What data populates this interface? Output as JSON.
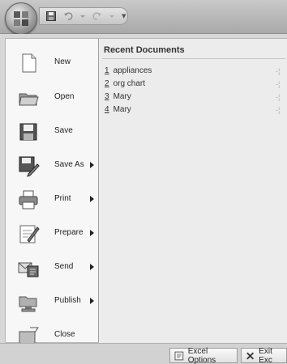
{
  "quick_access": {
    "qat_more": "▾"
  },
  "left_menu": [
    {
      "label": "New",
      "icon": "new-document-icon",
      "has_submenu": false
    },
    {
      "label": "Open",
      "icon": "open-folder-icon",
      "has_submenu": false
    },
    {
      "label": "Save",
      "icon": "save-disk-icon",
      "has_submenu": false
    },
    {
      "label": "Save As",
      "icon": "save-as-icon",
      "has_submenu": true
    },
    {
      "label": "Print",
      "icon": "printer-icon",
      "has_submenu": true
    },
    {
      "label": "Prepare",
      "icon": "prepare-icon",
      "has_submenu": true
    },
    {
      "label": "Send",
      "icon": "send-icon",
      "has_submenu": true
    },
    {
      "label": "Publish",
      "icon": "publish-icon",
      "has_submenu": true
    },
    {
      "label": "Close",
      "icon": "close-folder-icon",
      "has_submenu": false
    }
  ],
  "recent": {
    "title": "Recent Documents",
    "pin_glyph": "-¦",
    "items": [
      {
        "num": "1",
        "name": "appliances"
      },
      {
        "num": "2",
        "name": "org chart"
      },
      {
        "num": "3",
        "name": "Mary"
      },
      {
        "num": "4",
        "name": "Mary"
      }
    ]
  },
  "bottom": {
    "options_label": "Excel Options",
    "exit_label": "Exit Exc"
  }
}
